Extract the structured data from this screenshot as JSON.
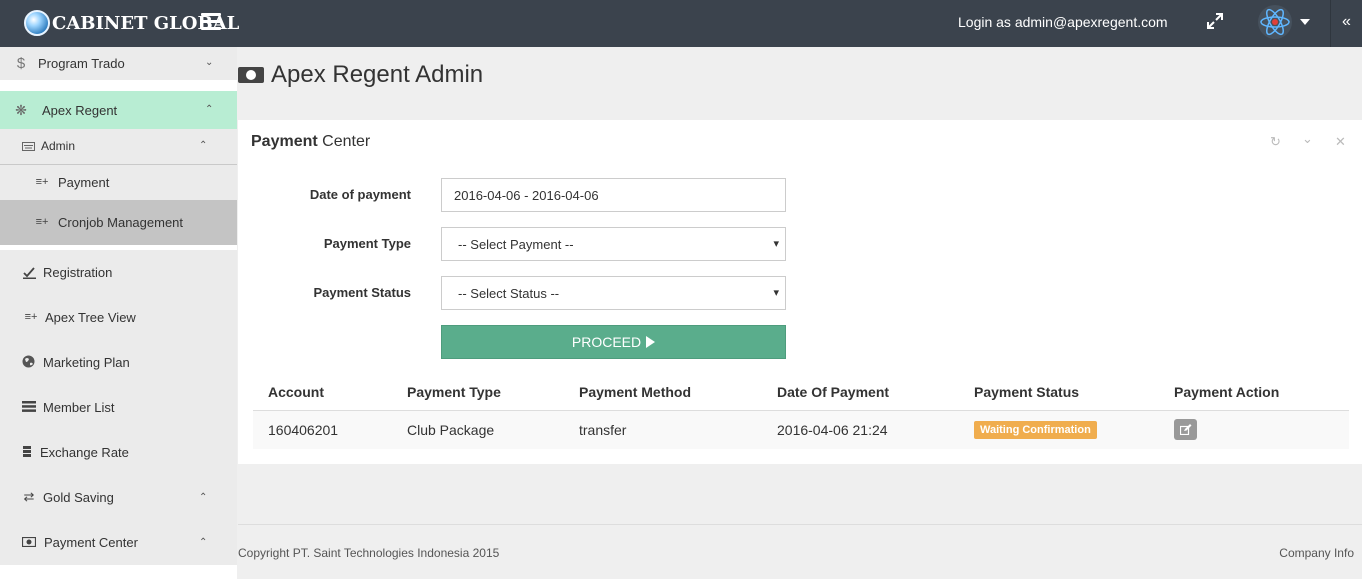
{
  "header": {
    "brand": "CABINET GLOBAL",
    "login_text": "Login as admin@apexregent.com"
  },
  "sidebar": {
    "program_trado": "Program Trado",
    "apex_regent": "Apex Regent",
    "admin": "Admin",
    "payment": "Payment",
    "cronjob": "Cronjob Management",
    "registration": "Registration",
    "apex_tree_view": "Apex Tree View",
    "marketing_plan": "Marketing Plan",
    "member_list": "Member List",
    "exchange_rate": "Exchange Rate",
    "gold_saving": "Gold Saving",
    "payment_center": "Payment Center"
  },
  "page": {
    "title": "Apex Regent Admin"
  },
  "panel": {
    "title_bold": "Payment",
    "title_rest": " Center",
    "form": {
      "date_label": "Date of payment",
      "date_value": "2016-04-06 - 2016-04-06",
      "type_label": "Payment Type",
      "type_selected": "-- Select Payment --",
      "status_label": "Payment Status",
      "status_selected": "-- Select Status --",
      "proceed_label": "PROCEED"
    },
    "table": {
      "columns": [
        "Account",
        "Payment Type",
        "Payment Method",
        "Date Of Payment",
        "Payment Status",
        "Payment Action"
      ],
      "rows": [
        {
          "account": "160406201",
          "payment_type": "Club Package",
          "payment_method": "transfer",
          "date": "2016-04-06 21:24",
          "status": "Waiting Confirmation"
        }
      ]
    }
  },
  "footer": {
    "copyright": "Copyright PT. Saint Technologies Indonesia 2015",
    "company_info": "Company Info"
  },
  "colors": {
    "topbar": "#3b434d",
    "active_menu": "#b8edd3",
    "proceed": "#5aad8c",
    "badge_warning": "#f0ad4e"
  }
}
